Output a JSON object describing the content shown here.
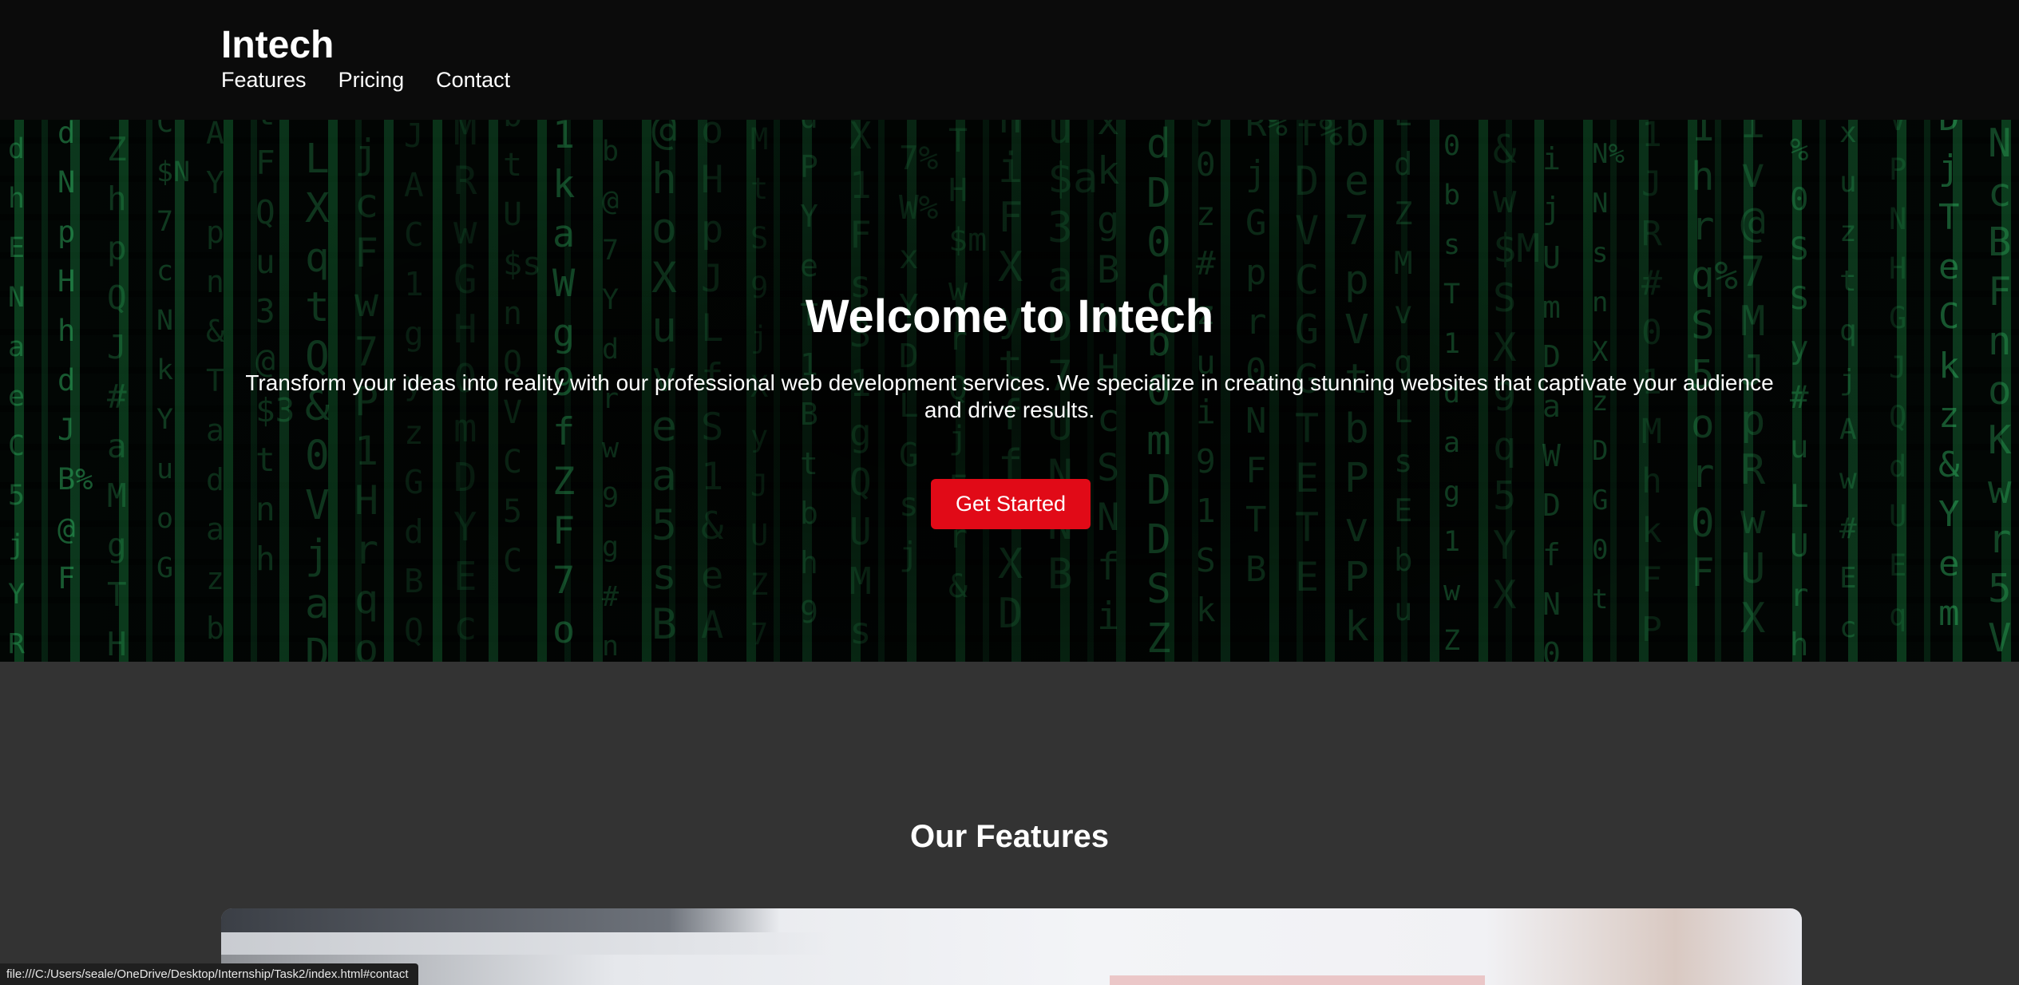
{
  "header": {
    "brand": "Intech",
    "nav": [
      "Features",
      "Pricing",
      "Contact"
    ]
  },
  "hero": {
    "title": "Welcome to Intech",
    "text": "Transform your ideas into reality with our professional web development services. We specialize in creating stunning websites that captivate your audience and drive results.",
    "cta_label": "Get Started"
  },
  "features": {
    "title": "Our Features"
  },
  "status_bar": {
    "url": "file:///C:/Users/seale/OneDrive/Desktop/Internship/Task2/index.html#contact"
  },
  "colors": {
    "header_bg": "#0b0b0b",
    "page_bg": "#333333",
    "accent": "#e10a17",
    "matrix_green": "#28c864"
  }
}
